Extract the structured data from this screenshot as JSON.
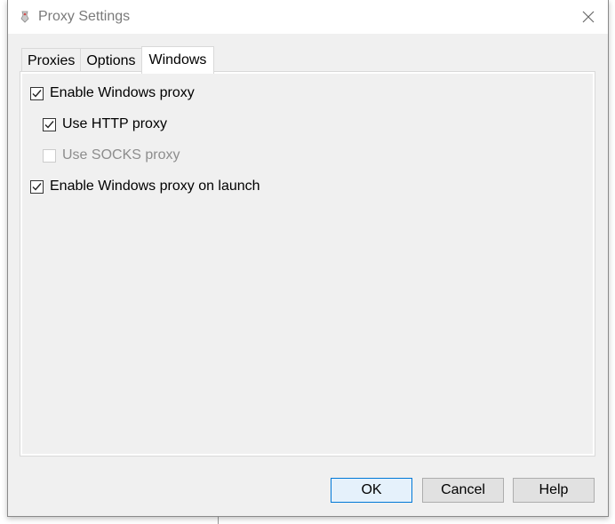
{
  "window": {
    "title": "Proxy Settings"
  },
  "tabs": [
    {
      "label": "Proxies",
      "active": false
    },
    {
      "label": "Options",
      "active": false
    },
    {
      "label": "Windows",
      "active": true
    }
  ],
  "options": {
    "enable_windows_proxy": {
      "label": "Enable Windows proxy",
      "checked": true,
      "enabled": true
    },
    "use_http_proxy": {
      "label": "Use HTTP proxy",
      "checked": true,
      "enabled": true
    },
    "use_socks_proxy": {
      "label": "Use SOCKS proxy",
      "checked": false,
      "enabled": false
    },
    "enable_on_launch": {
      "label": "Enable Windows proxy on launch",
      "checked": true,
      "enabled": true
    }
  },
  "buttons": {
    "ok": "OK",
    "cancel": "Cancel",
    "help": "Help"
  },
  "colors": {
    "accent": "#0078d7",
    "window_bg": "#f0f0f0",
    "disabled_text": "#8d8d8d"
  }
}
